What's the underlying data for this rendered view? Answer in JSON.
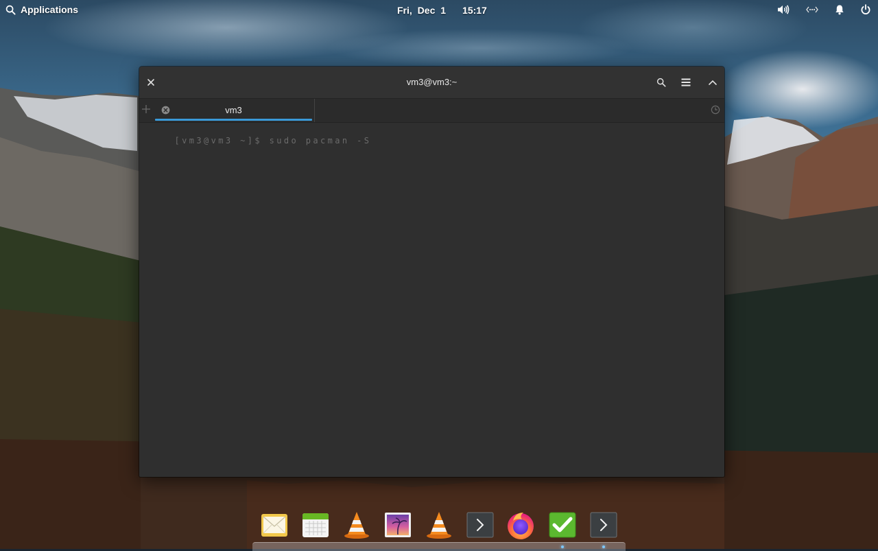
{
  "panel": {
    "applications_label": "Applications",
    "date": "Fri, Dec 1",
    "time": "15:17",
    "icons": [
      "search-icon",
      "volume-icon",
      "network-icon",
      "notifications-icon",
      "power-icon"
    ]
  },
  "window": {
    "title": "vm3@vm3:~",
    "buttons": [
      "close-icon",
      "search-icon",
      "menu-icon",
      "maximize-icon"
    ],
    "tabs": [
      {
        "label": "vm3",
        "active": true
      }
    ],
    "prompt_line": "[vm3@vm3 ~]$ sudo pacman -S"
  },
  "dock": {
    "items": [
      "mail-icon",
      "calendar-icon",
      "vlc-icon",
      "photos-icon",
      "vlc-icon",
      "terminal-icon",
      "firefox-icon",
      "tasks-icon",
      "terminal-icon"
    ]
  },
  "colors": {
    "accent": "#3a9ad9",
    "window_bg": "#2f2f2f",
    "prompt_text": "#6b6b6b"
  }
}
